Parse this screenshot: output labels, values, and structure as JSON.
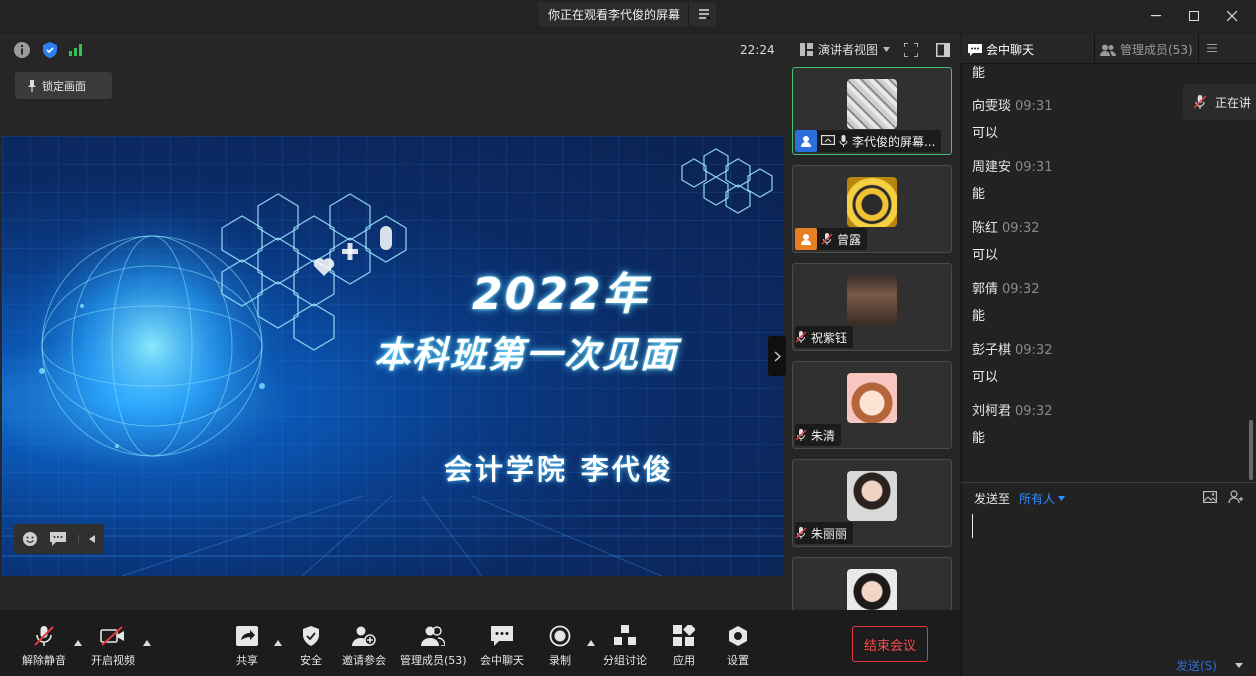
{
  "window": {
    "sharing_banner": "你正在观看李代俊的屏幕"
  },
  "meeting_bar": {
    "clock": "22:24",
    "view_mode": "演讲者视图",
    "lock_label": "锁定画面"
  },
  "slide": {
    "year": "2022年",
    "title": "本科班第一次见面",
    "presenter": "会计学院 李代俊"
  },
  "gallery": {
    "tiles": [
      {
        "name": "李代俊的屏幕...",
        "host": true,
        "sharing": true,
        "mic_muted": false
      },
      {
        "name": "曾露",
        "host": true,
        "sharing": false,
        "mic_muted": true
      },
      {
        "name": "祝紫钰",
        "host": false,
        "sharing": false,
        "mic_muted": true
      },
      {
        "name": "朱清",
        "host": false,
        "sharing": false,
        "mic_muted": true
      },
      {
        "name": "朱丽丽",
        "host": false,
        "sharing": false,
        "mic_muted": true
      },
      {
        "name": "",
        "host": false,
        "sharing": false,
        "mic_muted": true
      }
    ]
  },
  "chat": {
    "tab_chat": "会中聊天",
    "tab_members": "管理成员(53)",
    "messages": [
      {
        "name": "",
        "time": "",
        "text": "能"
      },
      {
        "name": "向雯琰",
        "time": "09:31",
        "text": "可以"
      },
      {
        "name": "周建安",
        "time": "09:31",
        "text": "能"
      },
      {
        "name": "陈红",
        "time": "09:32",
        "text": "可以"
      },
      {
        "name": "郭倩",
        "time": "09:32",
        "text": "能"
      },
      {
        "name": "彭子棋",
        "time": "09:32",
        "text": "可以"
      },
      {
        "name": "刘柯君",
        "time": "09:32",
        "text": "能"
      }
    ],
    "send_to_label": "发送至",
    "recipient": "所有人",
    "send_button": "发送(S)"
  },
  "toast": {
    "text": "正在讲"
  },
  "toolbar": {
    "unmute": "解除静音",
    "start_video": "开启视频",
    "share": "共享",
    "security": "安全",
    "invite": "邀请参会",
    "manage": "管理成员(53)",
    "chat": "会中聊天",
    "record": "录制",
    "breakout": "分组讨论",
    "apps": "应用",
    "settings": "设置",
    "end_meeting": "结束会议"
  },
  "colors": {
    "accent_blue": "#2d8cff",
    "end_red": "#e0393e",
    "active_green": "#3fbf6f",
    "host_badge_blue": "#2a6fdb",
    "host_badge_orange": "#e67e22"
  }
}
